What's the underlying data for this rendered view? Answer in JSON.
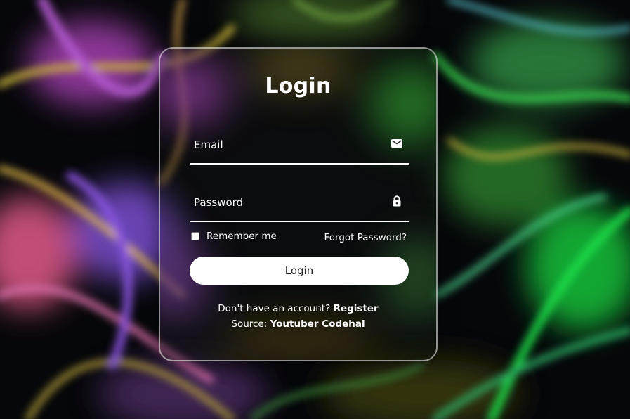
{
  "login": {
    "title": "Login",
    "email_placeholder": "Email",
    "password_placeholder": "Password",
    "remember_label": "Remember me",
    "remember_checked": false,
    "forgot_label": "Forgot Password?",
    "submit_label": "Login",
    "register_prompt": "Don't have an account?",
    "register_link": "Register",
    "source_label": "Source:",
    "source_value": "Youtuber Codehal"
  },
  "icons": {
    "email": "mail-icon",
    "password": "lock-icon"
  },
  "colors": {
    "text": "#ffffff",
    "button_bg": "#ffffff",
    "button_text": "#222222",
    "card_border": "#ffffffaa"
  }
}
